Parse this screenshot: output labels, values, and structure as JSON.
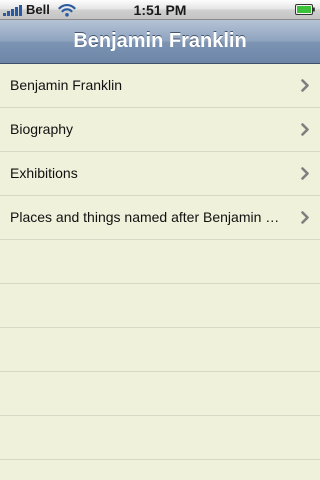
{
  "status_bar": {
    "carrier": "Bell",
    "time": "1:51 PM",
    "signal_bars": 5,
    "battery_level": 1.0,
    "icons": {
      "signal": "signal-strength-icon",
      "wifi": "wifi-icon",
      "battery": "battery-icon"
    }
  },
  "nav_bar": {
    "title": "Benjamin Franklin"
  },
  "table": {
    "rows": [
      {
        "label": "Benjamin Franklin",
        "accessory": "chevron-right-icon"
      },
      {
        "label": "Biography",
        "accessory": "chevron-right-icon"
      },
      {
        "label": "Exhibitions",
        "accessory": "chevron-right-icon"
      },
      {
        "label": "Places and things named after Benjamin Franklin",
        "accessory": "chevron-right-icon"
      }
    ],
    "empty_row_count": 5
  },
  "colors": {
    "background": "#f0f1db",
    "separator": "#d8d9c6",
    "nav_bar": "#7c93b3",
    "chevron": "#7f7f7f",
    "title_text": "#ffffff"
  }
}
